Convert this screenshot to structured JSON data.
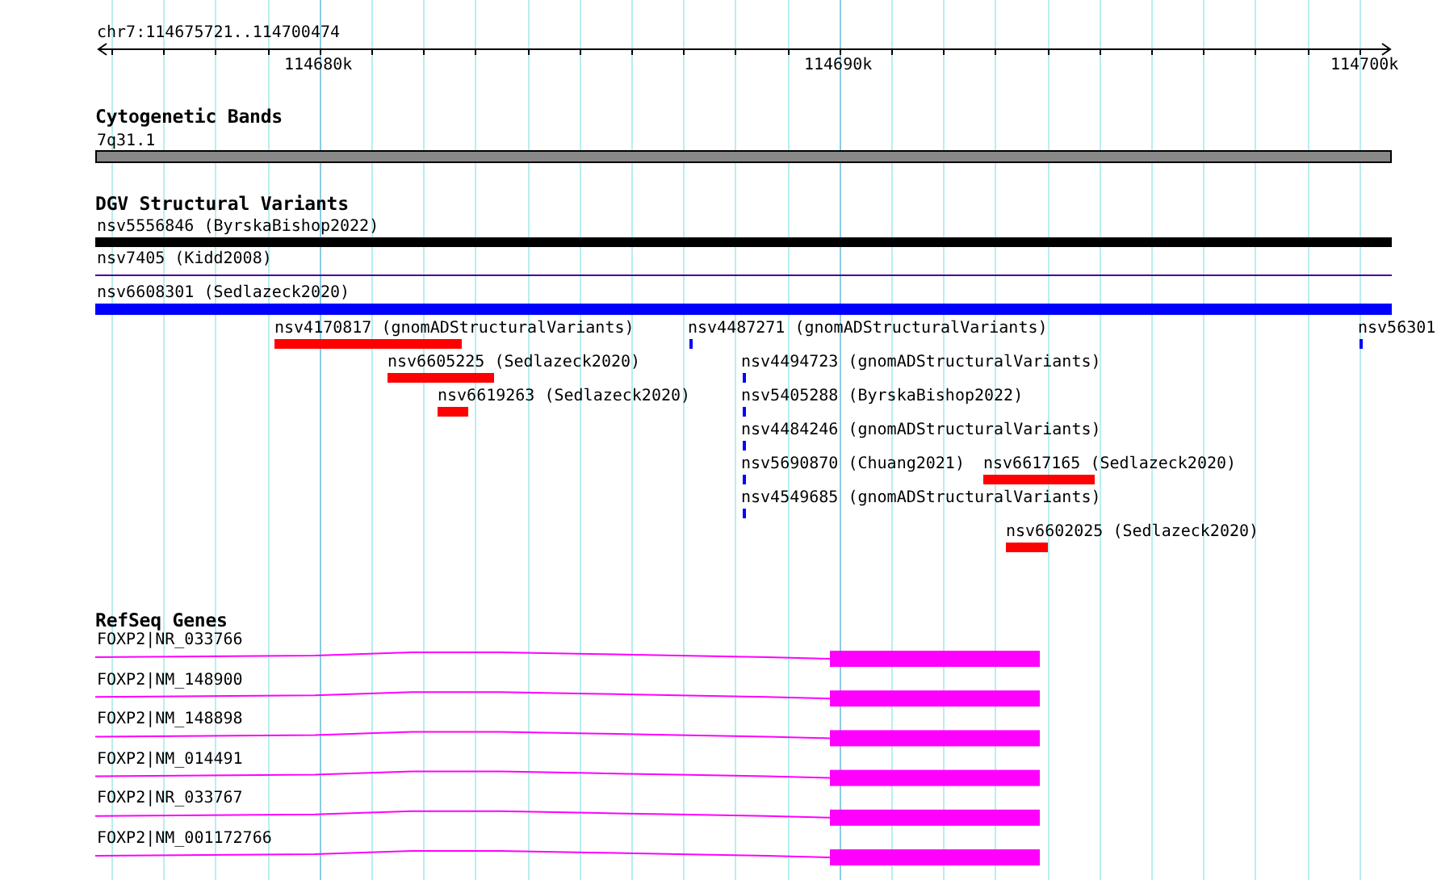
{
  "ruler": {
    "region": "chr7:114675721..114700474",
    "ticks": [
      "114680k",
      "114690k",
      "114700k"
    ]
  },
  "tracks": [
    {
      "kind": "bands",
      "title": "Cytogenetic Bands",
      "features": [
        {
          "label": "7q31.1",
          "color": "#888888"
        }
      ]
    },
    {
      "kind": "variants",
      "title": "DGV Structural Variants",
      "features": [
        {
          "label": "nsv5556846 (ByrskaBishop2022)",
          "color": "#000000"
        },
        {
          "label": "nsv7405 (Kidd2008)",
          "color": "#4b0082"
        },
        {
          "label": "nsv6608301 (Sedlazeck2020)",
          "color": "#0000ff"
        },
        {
          "label": "nsv4170817 (gnomADStructuralVariants)",
          "color": "#ff0000"
        },
        {
          "label": "nsv4487271 (gnomADStructuralVariants)",
          "color": "#0000ff"
        },
        {
          "label": "nsv56301",
          "color": "#0000ff"
        },
        {
          "label": "nsv6605225 (Sedlazeck2020)",
          "color": "#ff0000"
        },
        {
          "label": "nsv4494723 (gnomADStructuralVariants)",
          "color": "#0000ff"
        },
        {
          "label": "nsv6619263 (Sedlazeck2020)",
          "color": "#ff0000"
        },
        {
          "label": "nsv5405288 (ByrskaBishop2022)",
          "color": "#0000ff"
        },
        {
          "label": "nsv4484246 (gnomADStructuralVariants)",
          "color": "#0000ff"
        },
        {
          "label": "nsv5690870 (Chuang2021)",
          "color": "#0000ff"
        },
        {
          "label": "nsv6617165 (Sedlazeck2020)",
          "color": "#ff0000"
        },
        {
          "label": "nsv4549685 (gnomADStructuralVariants)",
          "color": "#0000ff"
        },
        {
          "label": "nsv6602025 (Sedlazeck2020)",
          "color": "#ff0000"
        }
      ]
    },
    {
      "kind": "genes",
      "title": "RefSeq Genes",
      "features": [
        {
          "label": "FOXP2|NR_033766",
          "color": "#ff00ff"
        },
        {
          "label": "FOXP2|NM_148900",
          "color": "#ff00ff"
        },
        {
          "label": "FOXP2|NM_148898",
          "color": "#ff00ff"
        },
        {
          "label": "FOXP2|NM_014491",
          "color": "#ff00ff"
        },
        {
          "label": "FOXP2|NR_033767",
          "color": "#ff00ff"
        },
        {
          "label": "FOXP2|NM_001172766",
          "color": "#ff00ff"
        }
      ]
    }
  ]
}
